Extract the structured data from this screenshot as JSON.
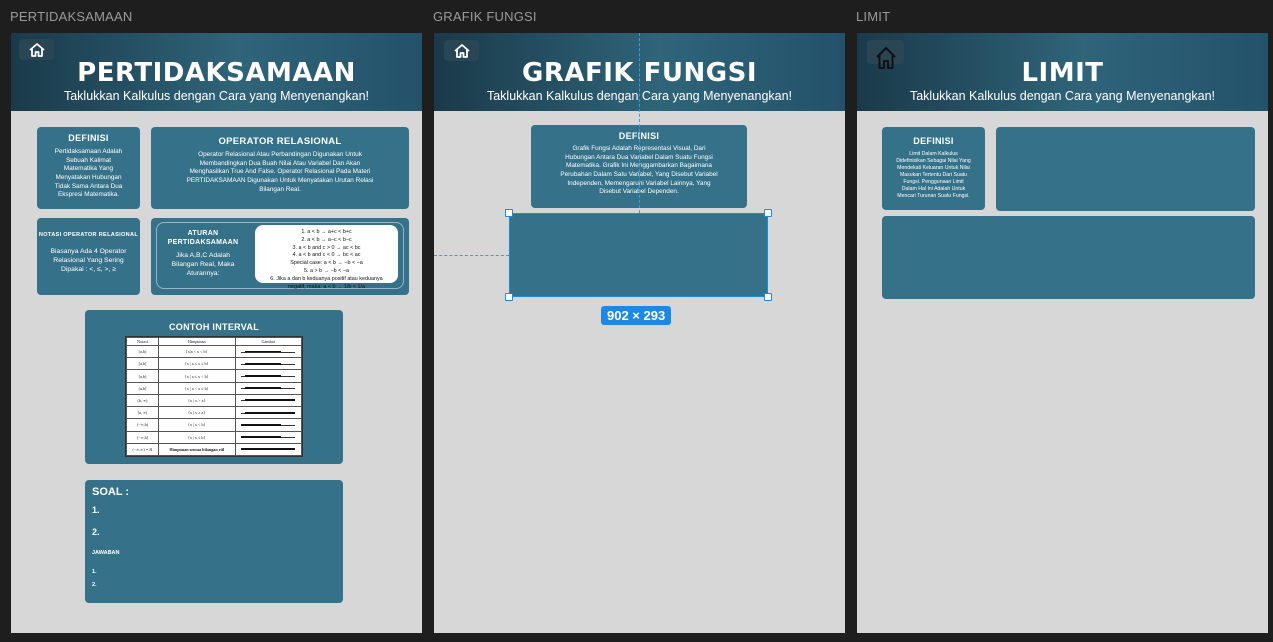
{
  "frames": [
    {
      "label": "PERTIDAKSAMAAN"
    },
    {
      "label": "GRAFIK FUNGSI"
    },
    {
      "label": "LIMIT"
    }
  ],
  "subtitle": "Taklukkan Kalkulus dengan Cara yang Menyenangkan!",
  "icons": {
    "home": "home-icon"
  },
  "colors": {
    "canvas": "#1e1e1e",
    "frame": "#d7d7d7",
    "card": "#357289",
    "banner_dark": "#1a3a4a",
    "selection": "#1e88e5"
  },
  "pertidaksamaan": {
    "title": "PERTIDAKSAMAAN",
    "definisi": {
      "heading": "DEFINISI",
      "lines": [
        "Pertidaksamaan Adalah",
        "Sebuah Kalimat",
        "Matematika Yang",
        "Menyatakan Hubungan",
        "Tidak Sama Antara Dua",
        "Ekspresi Matematika."
      ]
    },
    "operator": {
      "heading": "OPERATOR RELASIONAL",
      "lines": [
        "Operator Relasional Atau Perbandingan Digunakan Untuk",
        "Membandingkan Dua Buah Nilai Atau Variabel Dan Akan",
        "Menghasilkan True And False. Operator Relasional Pada Materi",
        "PERTIDAKSAMAAN Digunakan Untuk Menyatakan Urutan Relasi",
        "Bilangan Real."
      ]
    },
    "notasi": {
      "heading": "NOTASI OPERATOR RELASIONAL",
      "lines": [
        "Biasanya Ada 4 Operator",
        "Relasional Yang Sering",
        "Dipakai : <, ≤, >, ≥"
      ]
    },
    "aturan": {
      "heading_lines": [
        "ATURAN",
        "PERTIDAKSAMAAN"
      ],
      "desc_lines": [
        "Jika A,B,C Adalah",
        "Bilangan Real, Maka",
        "Aturannya:"
      ],
      "rules": [
        "1.  a < b → a+c < b+c",
        "2.  a < b → a−c < b−c",
        "3.  a < b and c > 0 → ac < bc",
        "4.  a < b and c < 0 → bc < ac",
        "Special case: a < b → −b < −a",
        "5. a > b → −b < −a",
        "6. Jika a dan b keduanya positif atau keduanya",
        "negatif, maka: a < b → 1/b < 1/a"
      ]
    },
    "contoh": {
      "heading": "CONTOH INTERVAL",
      "table": {
        "headers": [
          "Notasi",
          "Himpunan",
          "Gambar"
        ],
        "rows": [
          {
            "notasi": "(a,b)",
            "himpunan": "{x|a < x < b}"
          },
          {
            "notasi": "[a,b]",
            "himpunan": "{x | a ≤ x ≤ b}"
          },
          {
            "notasi": "[a,b)",
            "himpunan": "{x | a ≤ x < b}"
          },
          {
            "notasi": "(a,b]",
            "himpunan": "{x | a < x ≤ b}"
          },
          {
            "notasi": "(b, ∞)",
            "himpunan": "{x | x > a}"
          },
          {
            "notasi": "[a, ∞)",
            "himpunan": "{x | x ≥ a}"
          },
          {
            "notasi": "(−∞,b)",
            "himpunan": "{x | x < b}"
          },
          {
            "notasi": "(−∞,b]",
            "himpunan": "{x | x ≤ b}"
          },
          {
            "notasi": "(−∞,∞) = ℝ",
            "himpunan": "Himpunan semua bilangan riil"
          }
        ]
      }
    },
    "soal": {
      "heading": "SOAL :",
      "items": [
        "1.",
        "2."
      ],
      "jawaban_label": "JAWABAN",
      "jawaban_items": [
        "1.",
        "2."
      ]
    }
  },
  "grafik": {
    "title": "GRAFIK FUNGSI",
    "definisi": {
      "heading": "DEFINISI",
      "lines": [
        "Grafik Fungsi Adalah Representasi Visual, Dari",
        "Hubungan Antara Dua Variabel Dalam Suatu Fungsi",
        "Matematika. Grafik Ini Menggambarkan Bagaimana",
        "Perubahan Dalam Satu Variabel, Yang Disebut Variabel",
        "Independen, Memengaruhi Variabel Lainnya, Yang",
        "Disebut Variabel Dependen."
      ]
    },
    "selection": {
      "dimensions": "902 × 293"
    }
  },
  "limit": {
    "title": "LIMIT",
    "definisi": {
      "heading": "DEFINISI",
      "lines": [
        "Limit Dalam Kalkulus",
        "Didefinisikan Sebagai Nilai Yang",
        "Mendekati Keluaran Untuk Nilai",
        "Masukan Tertentu Dari Suatu",
        "Fungsi. Penggunaan Limit",
        "Dalam Hal Ini Adalah Untuk",
        "Mencari Turunan Suatu Fungsi."
      ]
    }
  }
}
